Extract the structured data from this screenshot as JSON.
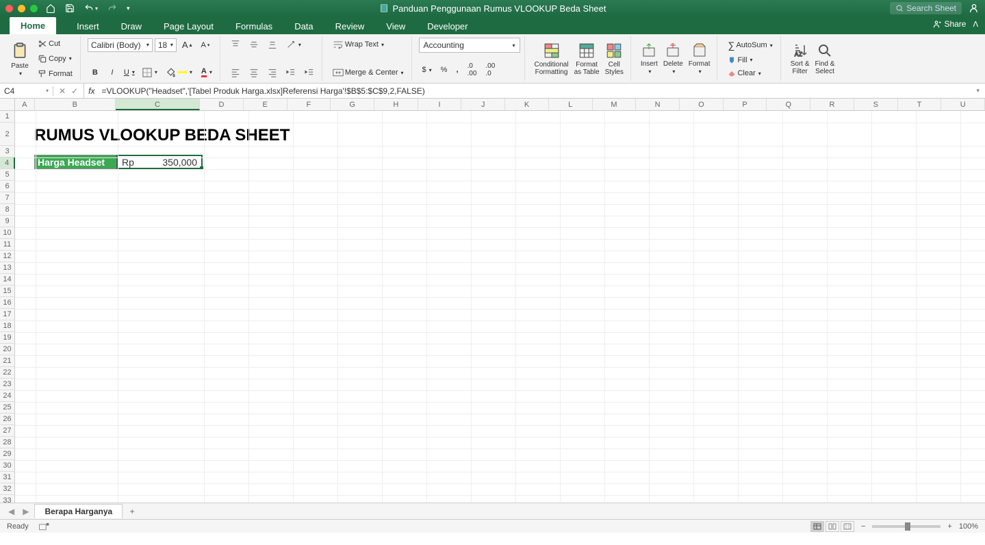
{
  "window": {
    "title": "Panduan Penggunaan Rumus VLOOKUP Beda Sheet",
    "search_placeholder": "Search Sheet"
  },
  "tabs": {
    "items": [
      "Home",
      "Insert",
      "Draw",
      "Page Layout",
      "Formulas",
      "Data",
      "Review",
      "View",
      "Developer"
    ],
    "active": "Home",
    "share_label": "Share"
  },
  "ribbon": {
    "paste": "Paste",
    "cut": "Cut",
    "copy": "Copy",
    "format_painter": "Format",
    "font_name": "Calibri (Body)",
    "font_size": "18",
    "wrap_text": "Wrap Text",
    "merge_center": "Merge & Center",
    "number_format": "Accounting",
    "cond_fmt": "Conditional\nFormatting",
    "fmt_table": "Format\nas Table",
    "cell_styles": "Cell\nStyles",
    "insert": "Insert",
    "delete": "Delete",
    "format": "Format",
    "autosum": "AutoSum",
    "fill": "Fill",
    "clear": "Clear",
    "sort_filter": "Sort &\nFilter",
    "find_select": "Find &\nSelect"
  },
  "formula_bar": {
    "cell_ref": "C4",
    "formula": "=VLOOKUP(\"Headset\",'[Tabel Produk Harga.xlsx]Referensi Harga'!$B$5:$C$9,2,FALSE)"
  },
  "sheet": {
    "columns": [
      "A",
      "B",
      "C",
      "D",
      "E",
      "F",
      "G",
      "H",
      "I",
      "J",
      "K",
      "L",
      "M",
      "N",
      "O",
      "P",
      "Q",
      "R",
      "S",
      "T",
      "U"
    ],
    "col_widths": {
      "A": 30,
      "B": 120,
      "C": 126,
      "default": 65
    },
    "selected_col": "C",
    "selected_row": 4,
    "title_text": "RUMUS VLOOKUP BEDA SHEET",
    "b4_label": "Harga Headset",
    "c4_currency": "Rp",
    "c4_value": "350,000",
    "tab_name": "Berapa Harganya"
  },
  "status": {
    "ready": "Ready",
    "zoom": "100%"
  }
}
